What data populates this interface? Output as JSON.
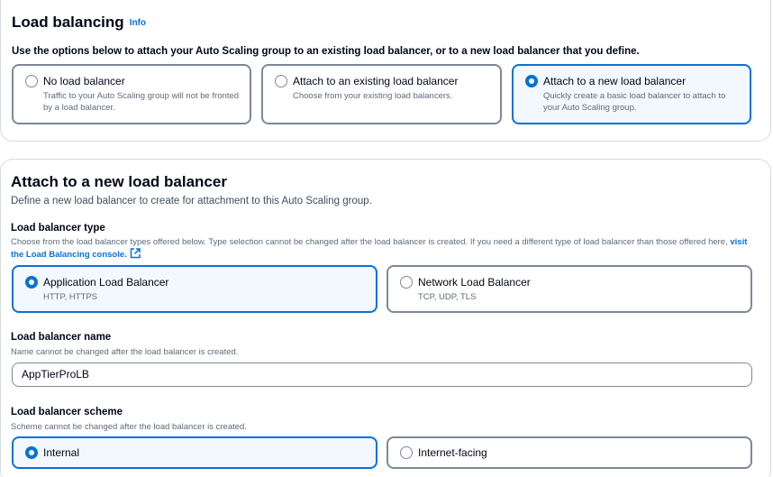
{
  "lb_section": {
    "title": "Load balancing",
    "info": "Info",
    "description": "Use the options below to attach your Auto Scaling group to an existing load balancer, or to a new load balancer that you define.",
    "options": [
      {
        "title": "No load balancer",
        "sub": "Traffic to your Auto Scaling group will not be fronted by a load balancer.",
        "selected": false
      },
      {
        "title": "Attach to an existing load balancer",
        "sub": "Choose from your existing load balancers.",
        "selected": false
      },
      {
        "title": "Attach to a new load balancer",
        "sub": "Quickly create a basic load balancer to attach to your Auto Scaling group.",
        "selected": true
      }
    ]
  },
  "new_lb": {
    "title": "Attach to a new load balancer",
    "description": "Define a new load balancer to create for attachment to this Auto Scaling group.",
    "type": {
      "label": "Load balancer type",
      "hint_prefix": "Choose from the load balancer types offered below. Type selection cannot be changed after the load balancer is created. If you need a different type of load balancer than those offered here,",
      "hint_link": "visit the Load Balancing console.",
      "options": [
        {
          "title": "Application Load Balancer",
          "sub": "HTTP, HTTPS",
          "selected": true
        },
        {
          "title": "Network Load Balancer",
          "sub": "TCP, UDP, TLS",
          "selected": false
        }
      ]
    },
    "name": {
      "label": "Load balancer name",
      "hint": "Name cannot be changed after the load balancer is created.",
      "value": "AppTierProLB"
    },
    "scheme": {
      "label": "Load balancer scheme",
      "hint": "Scheme cannot be changed after the load balancer is created.",
      "options": [
        {
          "title": "Internal",
          "selected": true
        },
        {
          "title": "Internet-facing",
          "selected": false
        }
      ]
    }
  },
  "colors": {
    "accent": "#0972d3",
    "selected_bg": "#f2f8fd",
    "border": "#7d8998"
  }
}
